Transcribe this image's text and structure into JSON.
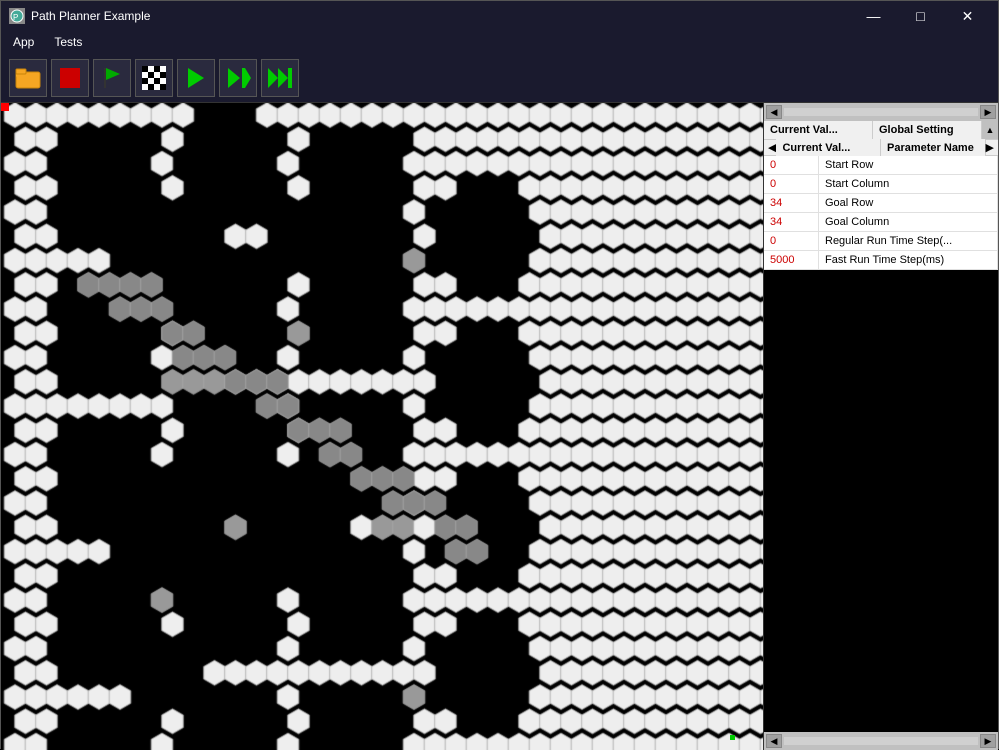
{
  "window": {
    "title": "Path Planner Example",
    "icon": "⚙"
  },
  "title_controls": {
    "minimize": "—",
    "maximize": "□",
    "close": "✕"
  },
  "menu": {
    "items": [
      "App",
      "Tests"
    ]
  },
  "toolbar": {
    "buttons": [
      {
        "name": "open-folder",
        "icon": "📂",
        "color": "#f5a623"
      },
      {
        "name": "stop-red",
        "icon": "■",
        "color": "#cc0000"
      },
      {
        "name": "flag-green",
        "icon": "⚑",
        "color": "#00aa00"
      },
      {
        "name": "checkerboard",
        "icon": "▦",
        "color": "#888"
      },
      {
        "name": "play",
        "icon": "▶",
        "color": "#00cc00"
      },
      {
        "name": "play-next",
        "icon": "⏭",
        "color": "#00cc00"
      },
      {
        "name": "fast-forward",
        "icon": "⏩",
        "color": "#00cc00"
      }
    ]
  },
  "panel": {
    "top_scroll_left": "◀",
    "top_scroll_right": "▶",
    "global_settings_label": "Global Setting",
    "current_val_label": "Current Val...",
    "parameter_name_label": "Parameter Name",
    "nav_left": "◀",
    "nav_right": "▶",
    "rows": [
      {
        "value": "0",
        "parameter": "Start Row"
      },
      {
        "value": "0",
        "parameter": "Start Column"
      },
      {
        "value": "34",
        "parameter": "Goal Row"
      },
      {
        "value": "34",
        "parameter": "Goal Column"
      },
      {
        "value": "0",
        "parameter": "Regular Run Time Step(..."
      },
      {
        "value": "5000",
        "parameter": "Fast Run Time Step(ms)"
      }
    ],
    "bottom_nav_left": "◀",
    "bottom_nav_right": "▶"
  }
}
